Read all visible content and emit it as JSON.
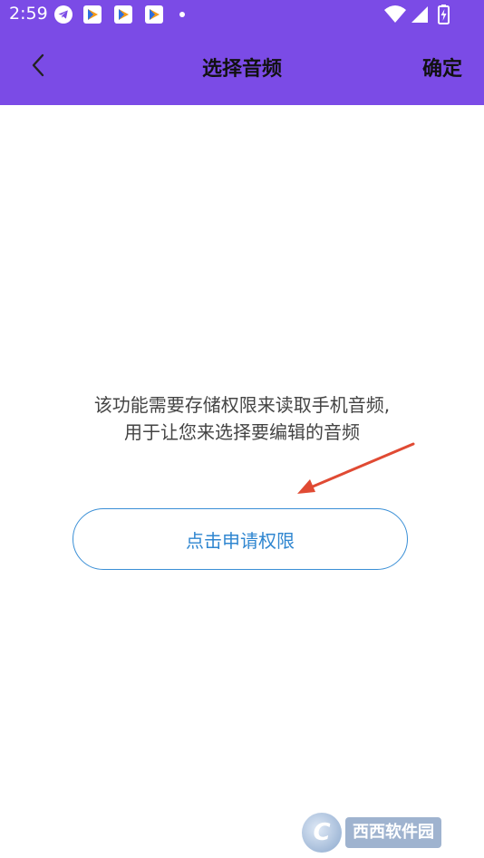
{
  "status_bar": {
    "time": "2:59",
    "icons": [
      "telegram-icon",
      "app-notification-icon",
      "app-notification-icon",
      "app-notification-icon",
      "dot-icon",
      "wifi-icon",
      "signal-icon",
      "battery-charging-icon"
    ]
  },
  "app_bar": {
    "title": "选择音频",
    "confirm_label": "确定",
    "back_icon": "chevron-left-icon",
    "background": "#7b4be6"
  },
  "main": {
    "message_line1": "该功能需要存储权限来读取手机音频,",
    "message_line2": "用于让您来选择要编辑的音频",
    "permission_button_label": "点击申请权限",
    "accent": "#2f86d0"
  },
  "watermark": {
    "logo_letter": "C",
    "text": "西西软件园"
  }
}
